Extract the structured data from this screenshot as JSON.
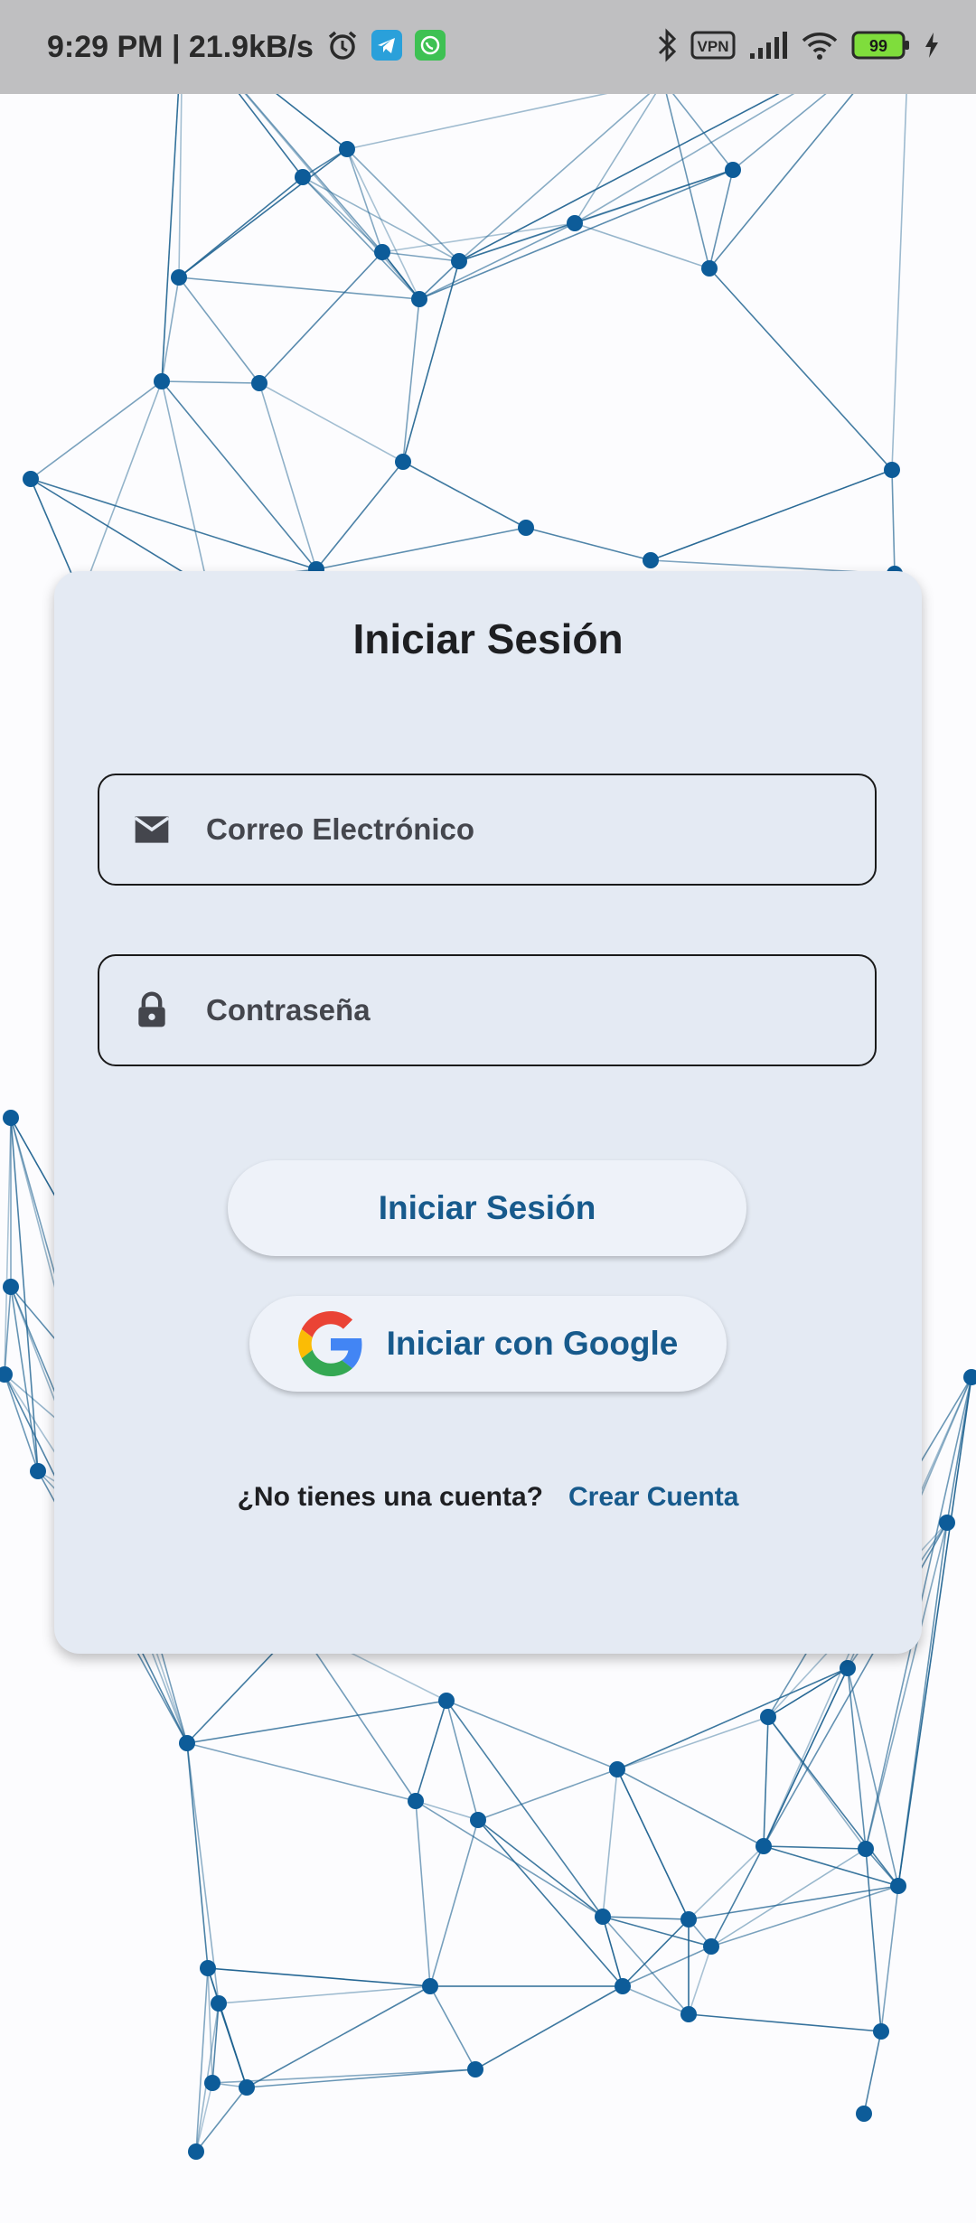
{
  "status_bar": {
    "time_speed": "9:29 PM | 21.9kB/s",
    "vpn_label": "VPN",
    "battery_level": "99",
    "icons": [
      "alarm-icon",
      "telegram-icon",
      "whatsapp-icon",
      "bluetooth-icon",
      "vpn-icon",
      "signal-icon",
      "wifi-icon",
      "battery-icon",
      "charging-icon"
    ]
  },
  "login": {
    "title": "Iniciar Sesión",
    "email_placeholder": "Correo Electrónico",
    "password_placeholder": "Contraseña",
    "login_button": "Iniciar Sesión",
    "google_button": "Iniciar con Google",
    "no_account_text": "¿No tienes una cuenta?",
    "create_account_link": "Crear Cuenta"
  },
  "colors": {
    "accent": "#175a8c",
    "card_background": "#e4eaf3",
    "network_node": "#0d5c99",
    "network_line": "#1a5f8e"
  }
}
